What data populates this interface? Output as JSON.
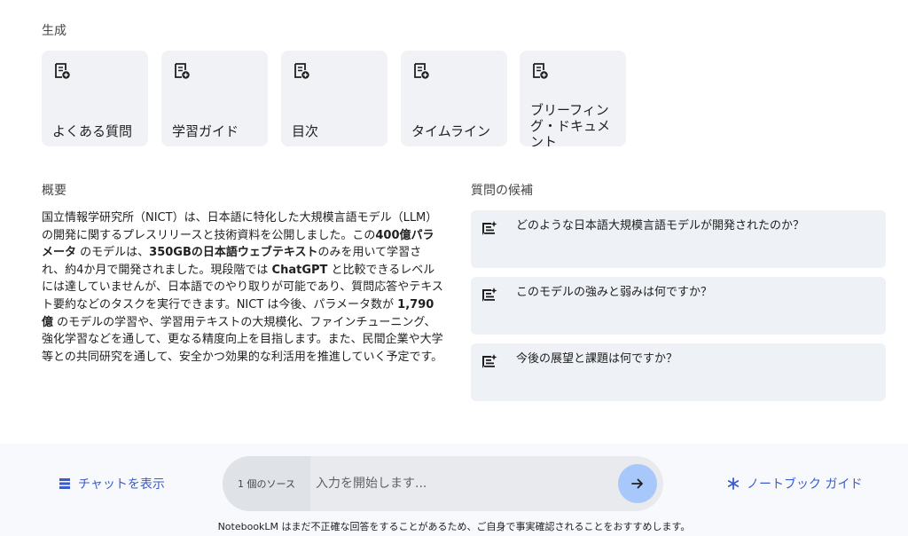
{
  "generate": {
    "heading": "生成",
    "cards": [
      {
        "label": "よくある質問",
        "icon": "note-add-icon"
      },
      {
        "label": "学習ガイド",
        "icon": "note-add-icon"
      },
      {
        "label": "目次",
        "icon": "note-add-icon"
      },
      {
        "label": "タイムライン",
        "icon": "note-add-icon"
      },
      {
        "label": "ブリーフィング・ドキュメント",
        "icon": "note-add-icon"
      }
    ]
  },
  "summary": {
    "heading": "概要",
    "seg1": "国立情報学研究所（NICT）は、日本語に特化した大規模言語モデル（LLM）の開発に関するプレスリリースと技術資料を公開しました。この",
    "b1": "400億パラメータ",
    "seg2": "のモデルは、",
    "b2": "350GBの日本語ウェブテキスト",
    "seg3": "のみを用いて学習され、約4か月で開発されました。現段階では",
    "b3": "ChatGPT",
    "seg4": "と比較できるレベルには達していませんが、日本語でのやり取りが可能であり、質問応答やテキスト要約などのタスクを実行できます。NICT は今後、パラメータ数が",
    "b4": "1,790億",
    "seg5": "のモデルの学習や、学習用テキストの大規模化、ファインチューニング、強化学習などを通して、更なる精度向上を目指します。また、民間企業や大学等との共同研究を通して、安全かつ効果的な利活用を推進していく予定です。"
  },
  "questions": {
    "heading": "質問の候補",
    "items": [
      {
        "text": "どのような日本語大規模言語モデルが開発されたのか？",
        "icon": "question-sparkle-icon"
      },
      {
        "text": "このモデルの強みと弱みは何ですか？",
        "icon": "question-sparkle-icon"
      },
      {
        "text": "今後の展望と課題は何ですか？",
        "icon": "question-sparkle-icon"
      }
    ]
  },
  "footer": {
    "chat_label": "チャットを表示",
    "chat_icon": "chat-list-icon",
    "source_chip": "1 個のソース",
    "input_placeholder": "入力を開始します...",
    "send_icon": "arrow-right-icon",
    "guide_label": "ノートブック ガイド",
    "guide_icon": "asterisk-icon",
    "disclaimer": "NotebookLM はまだ不正確な回答をすることがあるため、ご自身で事実確認されることをおすすめします。"
  },
  "colors": {
    "accent": "#3b5ccc",
    "card_bg": "#f0f2f5",
    "send_bg": "#a8c7fa"
  }
}
